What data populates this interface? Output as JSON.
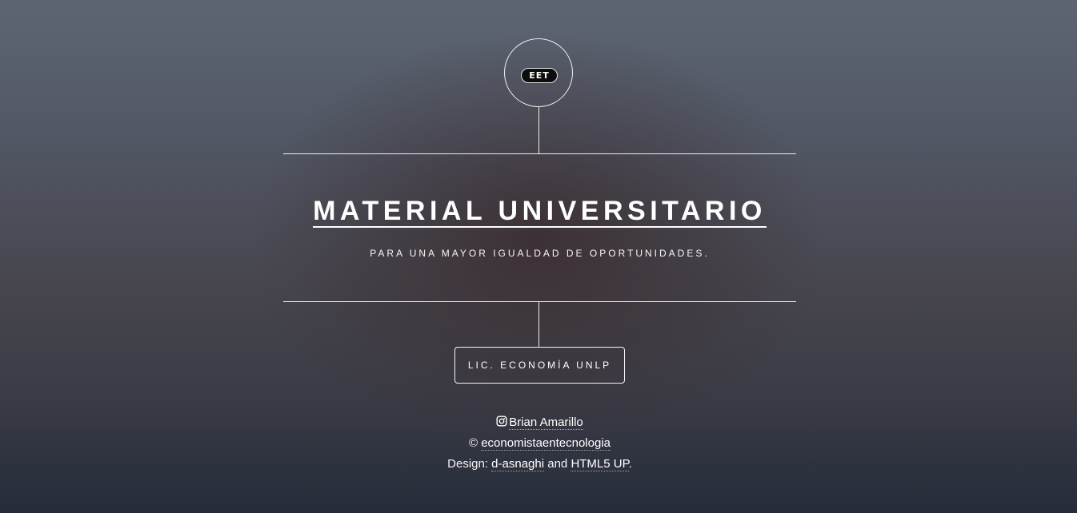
{
  "header": {
    "logo_text": "EET",
    "title": "MATERIAL UNIVERSITARIO",
    "subtitle": "PARA UNA MAYOR IGUALDAD DE OPORTUNIDADES."
  },
  "nav": {
    "button_label": "LIC. ECONOMÍA UNLP"
  },
  "footer": {
    "instagram_icon": "instagram-icon",
    "instagram_name": "Brian Amarillo",
    "copyright_symbol": "©",
    "copyright_link": "economistaentecnologia",
    "design_prefix": "Design:",
    "design_link_1": "d-asnaghi",
    "design_and": "and",
    "design_link_2": "HTML5 UP",
    "design_suffix": "."
  },
  "colors": {
    "background_top": "#5d6573",
    "background_bottom": "#252c3a",
    "foreground": "#ffffff"
  }
}
